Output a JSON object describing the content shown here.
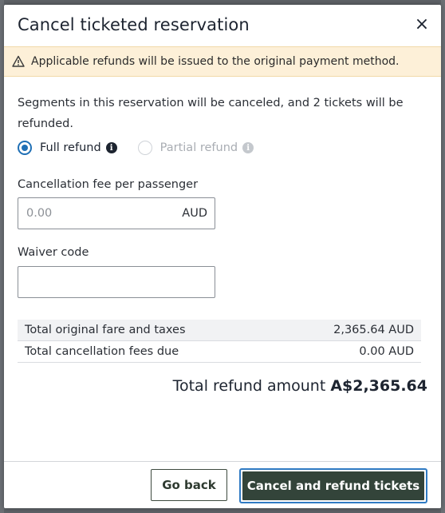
{
  "dialog": {
    "title": "Cancel ticketed reservation",
    "close_label": "×"
  },
  "banner": {
    "icon": "warning-icon",
    "text": "Applicable refunds will be issued to the original payment method."
  },
  "description": "Segments in this reservation will be canceled, and 2 tickets will be refunded.",
  "refund_options": [
    {
      "label": "Full refund",
      "selected": true,
      "disabled": false,
      "icon": "info-icon"
    },
    {
      "label": "Partial refund",
      "selected": false,
      "disabled": true,
      "icon": "info-icon"
    }
  ],
  "cancellation_fee": {
    "label": "Cancellation fee per passenger",
    "placeholder": "0.00",
    "value": "",
    "suffix": "AUD"
  },
  "waiver_code": {
    "label": "Waiver code",
    "value": ""
  },
  "totals": [
    {
      "label": "Total original fare and taxes",
      "value": "2,365.64 AUD"
    },
    {
      "label": "Total cancellation fees due",
      "value": "0.00 AUD"
    }
  ],
  "refund": {
    "label": "Total refund amount",
    "amount": "A$2,365.64"
  },
  "footer": {
    "back_label": "Go back",
    "confirm_label": "Cancel and refund tickets"
  },
  "colors": {
    "banner_bg": "#fdf0d8",
    "primary_button": "#33443a",
    "radio_selected": "#1f6fb5",
    "focus_ring": "#2f7ac3"
  }
}
